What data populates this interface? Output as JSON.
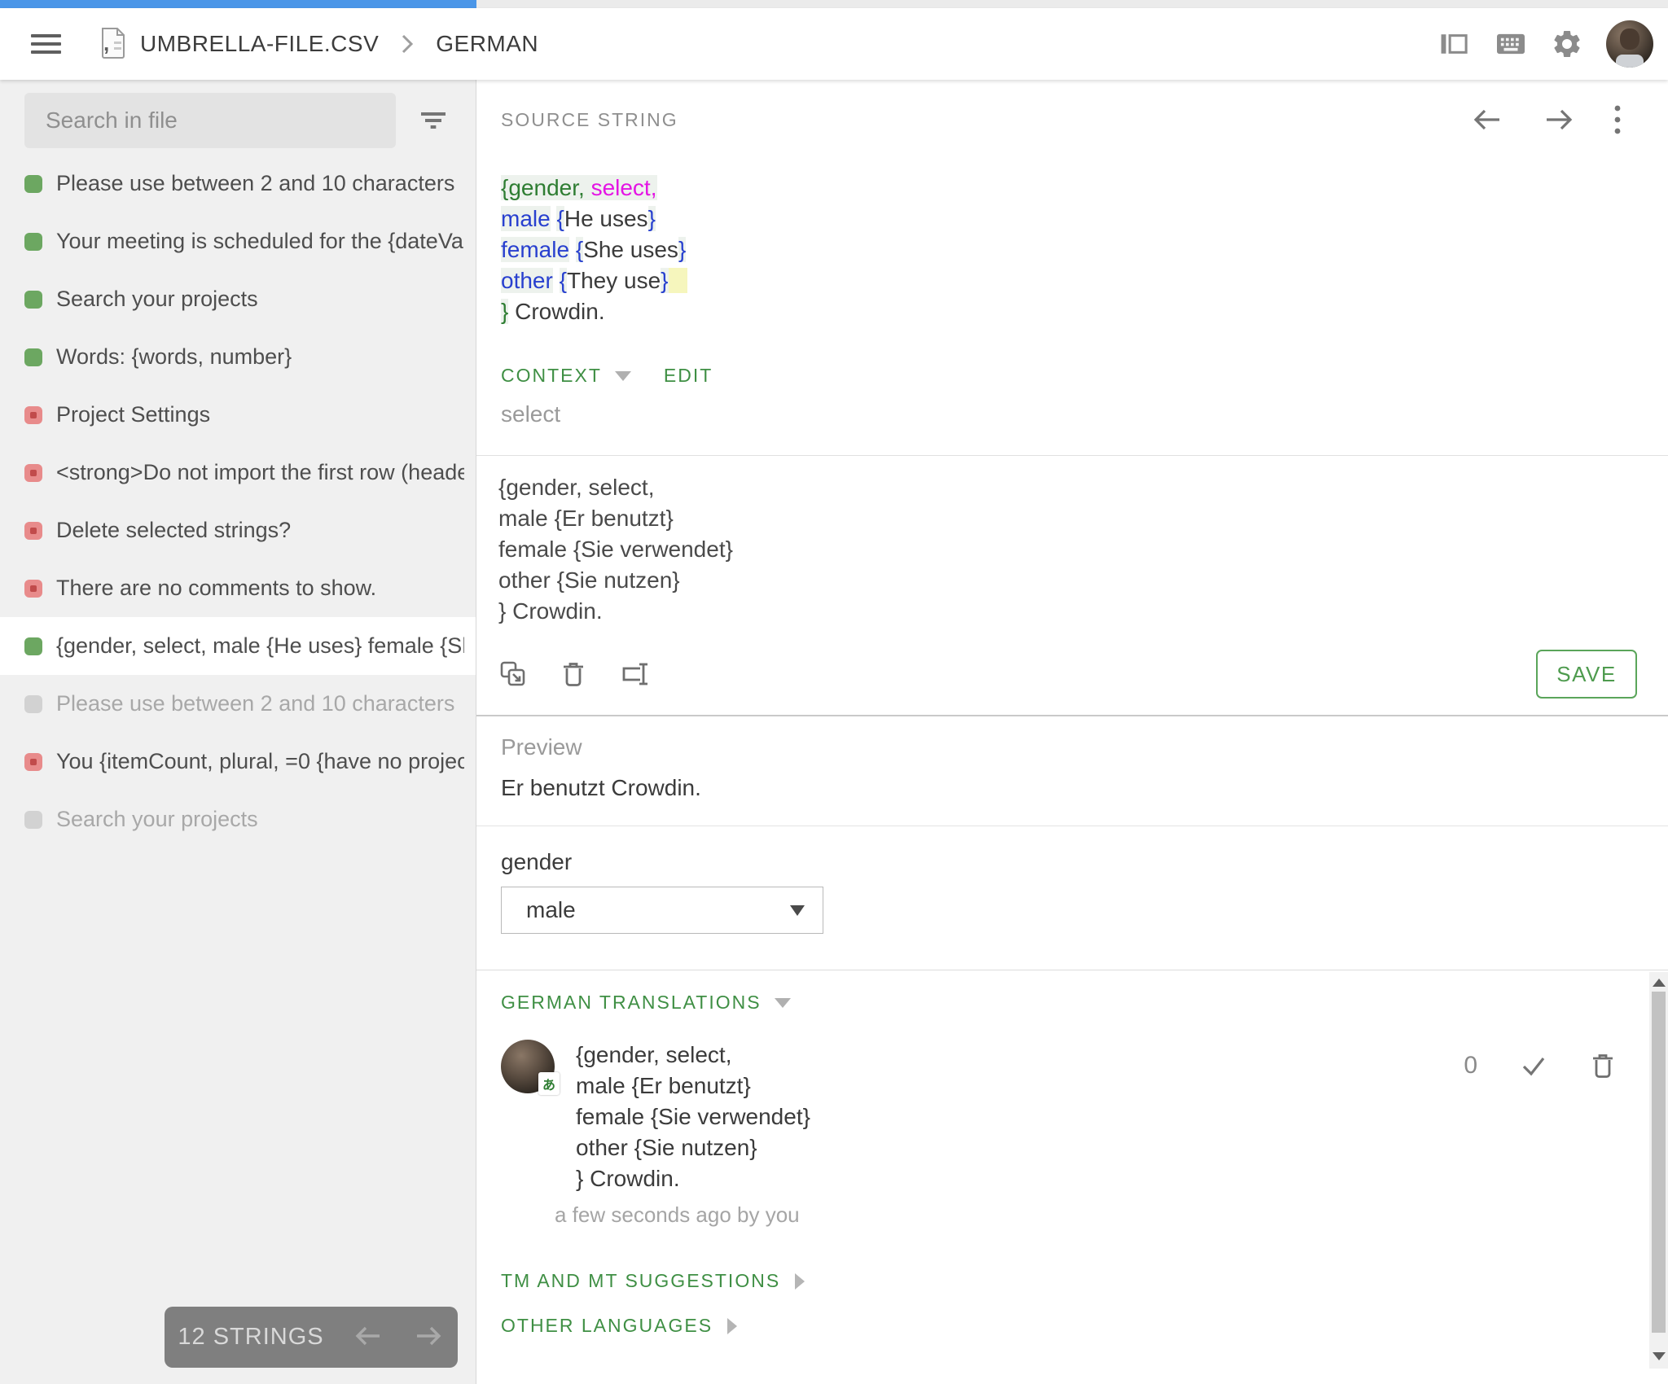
{
  "progress": {
    "value_pct": 28.6,
    "bar_color": "#4a96e8"
  },
  "topbar": {
    "breadcrumb": {
      "file": "UMBRELLA-FILE.CSV",
      "language": "GERMAN"
    }
  },
  "sidebar": {
    "search_placeholder": "Search in file",
    "items": [
      {
        "label": "Please use between 2 and 10 characters",
        "status": "translated",
        "selected": false
      },
      {
        "label": "Your meeting is scheduled for the {dateVal…",
        "status": "translated",
        "selected": false
      },
      {
        "label": "Search your projects",
        "status": "translated",
        "selected": false
      },
      {
        "label": "Words: {words, number}",
        "status": "translated",
        "selected": false
      },
      {
        "label": "Project Settings",
        "status": "untranslated",
        "selected": false
      },
      {
        "label": "<strong>Do not import the first row (heade…",
        "status": "untranslated",
        "selected": false
      },
      {
        "label": "Delete selected strings?",
        "status": "untranslated",
        "selected": false
      },
      {
        "label": "There are no comments to show.",
        "status": "untranslated",
        "selected": false
      },
      {
        "label": "{gender, select, male {He uses} female {Sh…",
        "status": "translated",
        "selected": true
      },
      {
        "label": "Please use between 2 and 10 characters",
        "status": "hidden",
        "selected": false
      },
      {
        "label": "You {itemCount, plural, =0 {have no project…",
        "status": "untranslated",
        "selected": false
      },
      {
        "label": "Search your projects",
        "status": "hidden",
        "selected": false
      }
    ],
    "strings_count_label": "12 STRINGS"
  },
  "source_panel": {
    "title": "SOURCE STRING",
    "source_lines": [
      [
        {
          "t": "{gender,",
          "c": "tok-green hl"
        },
        {
          "t": " ",
          "c": "hl"
        },
        {
          "t": "select,",
          "c": "tok-magenta hl"
        }
      ],
      [
        {
          "t": "male",
          "c": "tok-blue hl"
        },
        {
          "t": " ",
          "c": ""
        },
        {
          "t": "{",
          "c": "tok-blue hl"
        },
        {
          "t": "He uses",
          "c": ""
        },
        {
          "t": "}",
          "c": "tok-blue hl"
        }
      ],
      [
        {
          "t": "female",
          "c": "tok-blue hl"
        },
        {
          "t": " ",
          "c": ""
        },
        {
          "t": "{",
          "c": "tok-blue hl"
        },
        {
          "t": "She uses",
          "c": ""
        },
        {
          "t": "}",
          "c": "tok-blue hl"
        }
      ],
      [
        {
          "t": "other",
          "c": "tok-blue hl"
        },
        {
          "t": " ",
          "c": ""
        },
        {
          "t": "{",
          "c": "tok-blue hl"
        },
        {
          "t": "They use",
          "c": ""
        },
        {
          "t": "}",
          "c": "tok-blue hl"
        },
        {
          "t": " ",
          "c": "hl-yellow"
        }
      ],
      [
        {
          "t": "}",
          "c": "tok-green hl"
        },
        {
          "t": " Crowdin.",
          "c": ""
        }
      ]
    ],
    "context_label": "CONTEXT",
    "edit_label": "EDIT",
    "context_value": "select"
  },
  "translation_form": {
    "lines": [
      "{gender, select,",
      "male {Er benutzt}",
      "female {Sie verwendet}",
      "other {Sie nutzen}",
      "} Crowdin."
    ],
    "save_label": "SAVE"
  },
  "preview": {
    "label": "Preview",
    "value": "Er benutzt Crowdin."
  },
  "icu_controls": {
    "param_label": "gender",
    "selected_option": "male"
  },
  "translations_panel": {
    "title": "GERMAN TRANSLATIONS",
    "entries": [
      {
        "lines": [
          "{gender, select,",
          "male {Er benutzt}",
          "female {Sie verwendet}",
          "other {Sie nutzen}",
          "} Crowdin."
        ],
        "meta": "a few seconds ago by you",
        "votes": "0",
        "avatar_badge": "あ"
      }
    ],
    "tm_label": "TM AND MT SUGGESTIONS",
    "other_label": "OTHER LANGUAGES"
  },
  "colors": {
    "accent_green": "#3f8f44",
    "save_green": "#5aa55a",
    "progress_blue": "#4a96e8",
    "status_translated": "#6ca761",
    "status_untranslated": "#e88b8b",
    "status_hidden": "#d2d2d2",
    "token_green": "#2e7d32",
    "token_magenta": "#e414e4",
    "token_blue": "#2840cf",
    "highlight_yellow": "#f6f6bd"
  },
  "icons": [
    "menu-icon",
    "csv-file-icon",
    "chevron-right-icon",
    "side-panel-icon",
    "keyboard-icon",
    "gear-icon",
    "filter-icon",
    "arrow-back-icon",
    "arrow-forward-icon",
    "kebab-menu-icon",
    "copy-source-icon",
    "trash-icon",
    "text-select-icon",
    "check-icon",
    "triangle-down-icon",
    "triangle-right-icon"
  ]
}
